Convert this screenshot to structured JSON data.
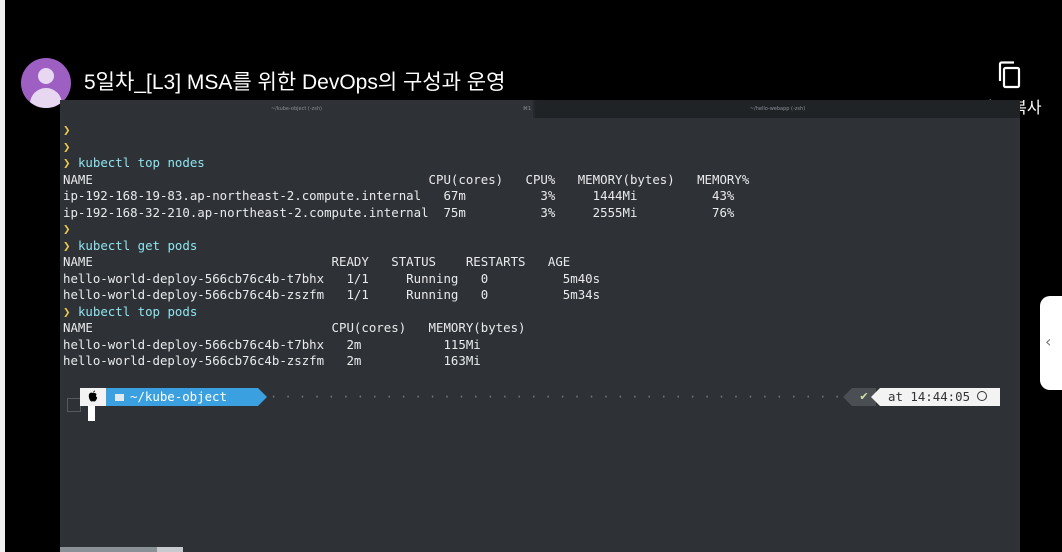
{
  "header": {
    "title": "5일차_[L3] MSA를 위한 DevOps의 구성과 운영",
    "copy_label": "링크 복사"
  },
  "tabs": [
    {
      "label": "~/kube-object (-zsh)",
      "shortcut": "⌘1"
    },
    {
      "label": "~/hello-webapp (-zsh)"
    }
  ],
  "terminal": {
    "lines": [
      {
        "type": "prompt",
        "arrow": "❯",
        "command": ""
      },
      {
        "type": "prompt",
        "arrow": "❯",
        "command": ""
      },
      {
        "type": "prompt",
        "arrow": "❯",
        "command": "kubectl top nodes"
      },
      {
        "type": "output",
        "text": "NAME                                             CPU(cores)   CPU%   MEMORY(bytes)   MEMORY%"
      },
      {
        "type": "output",
        "text": "ip-192-168-19-83.ap-northeast-2.compute.internal   67m          3%     1444Mi          43%"
      },
      {
        "type": "output",
        "text": "ip-192-168-32-210.ap-northeast-2.compute.internal  75m          3%     2555Mi          76%"
      },
      {
        "type": "prompt",
        "arrow": "❯",
        "command": ""
      },
      {
        "type": "prompt",
        "arrow": "❯",
        "command": "kubectl get pods"
      },
      {
        "type": "output",
        "text": "NAME                                READY   STATUS    RESTARTS   AGE"
      },
      {
        "type": "output",
        "text": "hello-world-deploy-566cb76c4b-t7bhx   1/1     Running   0          5m40s"
      },
      {
        "type": "output",
        "text": "hello-world-deploy-566cb76c4b-zszfm   1/1     Running   0          5m34s"
      },
      {
        "type": "prompt",
        "arrow": "❯",
        "command": "kubectl top pods"
      },
      {
        "type": "output",
        "text": "NAME                                CPU(cores)   MEMORY(bytes)"
      },
      {
        "type": "output",
        "text": "hello-world-deploy-566cb76c4b-t7bhx   2m           115Mi"
      },
      {
        "type": "output",
        "text": "hello-world-deploy-566cb76c4b-zszfm   2m           163Mi"
      }
    ]
  },
  "prompt_bar": {
    "apple": "",
    "directory": "~/kube-object",
    "status": "✔",
    "time": "at 14:44:05"
  },
  "icons": {
    "copy": "copy-icon",
    "apple": "apple-icon",
    "folder": "folder-icon",
    "clock": "clock-icon",
    "chevron": "chevron-left-icon"
  },
  "colors": {
    "terminal_bg": "#2e3237",
    "prompt_arrow": "#e9c84e",
    "command": "#8ee4ef",
    "dir_segment": "#3aa0df",
    "avatar": "#9d5fc2"
  }
}
